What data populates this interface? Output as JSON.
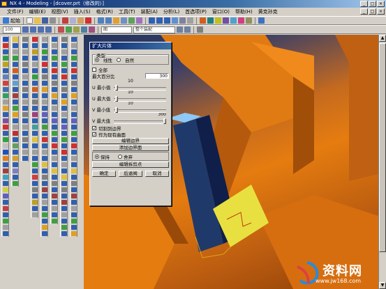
{
  "window": {
    "title": "NX 4 - Modeling - [dcover.prt（修改的）]",
    "min": "_",
    "max": "□",
    "close": "×"
  },
  "menu": {
    "items": [
      "文件(F)",
      "编辑(E)",
      "视图(V)",
      "插入(S)",
      "格式(R)",
      "工具(T)",
      "装配(A)",
      "分析(L)",
      "首选项(P)",
      "窗口(O)",
      "帮助(H)",
      "黄克孙克"
    ]
  },
  "toolbar": {
    "start_label": "起始",
    "zoom_value": "100",
    "layer_dropdown": "图",
    "filter_dropdown": "整个装配"
  },
  "dialog": {
    "title": "扩大片体",
    "type_label": "类型",
    "type_linear": "线性",
    "type_natural": "自然",
    "all_label": "全部",
    "percent_label": "最大百分比",
    "percent_value": "300",
    "u_min_label": "U 最小值",
    "u_min_value": "10",
    "u_max_label": "U 最大值",
    "u_max_value": "10",
    "v_min_label": "V 最小值",
    "v_min_value": "10",
    "v_max_label": "V 最大值",
    "v_max_value": "300",
    "trim_label": "切割到边界",
    "as_new_label": "作为现有曲面",
    "edit_boundary_label": "编辑边界",
    "add_boundary_label": "添加边界面",
    "keep_label": "保持",
    "discard_label": "舍弃",
    "edit_trim_label": "编辑拆剪点",
    "ok_label": "确定",
    "back_label": "后退阀",
    "cancel_label": "取消"
  },
  "watermark": {
    "name": "资料网",
    "url": "www.jw168.com"
  }
}
